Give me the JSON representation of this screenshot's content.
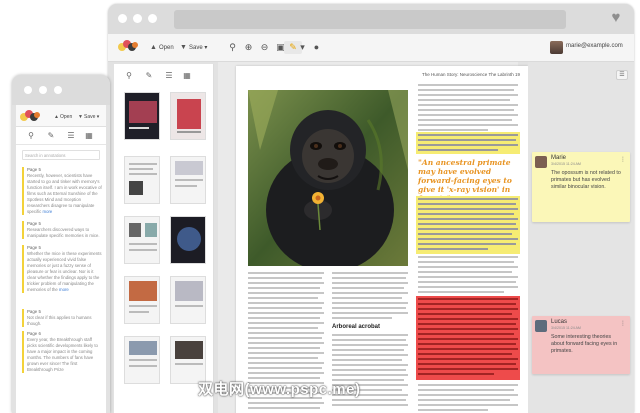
{
  "toolbar": {
    "open_label": "Open",
    "save_label": "Save",
    "user_email": "marie@example.com"
  },
  "document": {
    "running_head": "The Human Story: Neuroscience  The Labrinth  19",
    "quote": "\"An ancestral primate may have evolved forward-facing eyes to give it 'x-ray vision' in forests\"",
    "section_heading": "Arboreal acrobat"
  },
  "notes": [
    {
      "author": "Marie",
      "date": "3/4/2015 11:24 AM",
      "body": "The opossum is not related to primates but has evolved similar binocular vision.",
      "avatar_color": "#7b5f52"
    },
    {
      "author": "Lucas",
      "date": "3/4/2015 11:24 AM",
      "body": "Some interesting theories about forward facing eyes in primates.",
      "avatar_color": "#5d6b7c"
    }
  ],
  "sidebar": {
    "open_label": "Open",
    "save_label": "Save",
    "search_placeholder": "Search in annotations",
    "annotations": [
      {
        "page": "Page 5",
        "text": "Recently, however, scientists have started to go and tinker with memory's function itself. I am in work evocative of films such as Eternal Sunshine of the Spotless Mind and Inception researchers disagree to manipulate specific",
        "more": "more"
      },
      {
        "page": "Page 5",
        "text": "Researchers discovered ways to manipulate specific memories in mice.",
        "more": ""
      },
      {
        "page": "Page 5",
        "text": "Whether the mice in these experiments actually experienced vivid false memories or just a fuzzy sense of pleasure or fear is unclear. Nor is it clear whether the findings apply to the trickier problem of manipulating the memories of the",
        "more": "more"
      },
      {
        "page": "Page 5",
        "text": "Not clear if this applies to humans though.",
        "more": ""
      },
      {
        "page": "Page 6",
        "text": "Every year, the Breakthrough staff picks scientific developments likely to have a major impact in the coming months. The numbers of fans have grown ever since! The first Breakthrough Prize",
        "more": ""
      }
    ]
  },
  "watermark": "双电网(www.pspc.me)",
  "icons": {
    "heart": "heart-icon",
    "menu": "more-vertical-icon",
    "comment": "comment-icon"
  }
}
